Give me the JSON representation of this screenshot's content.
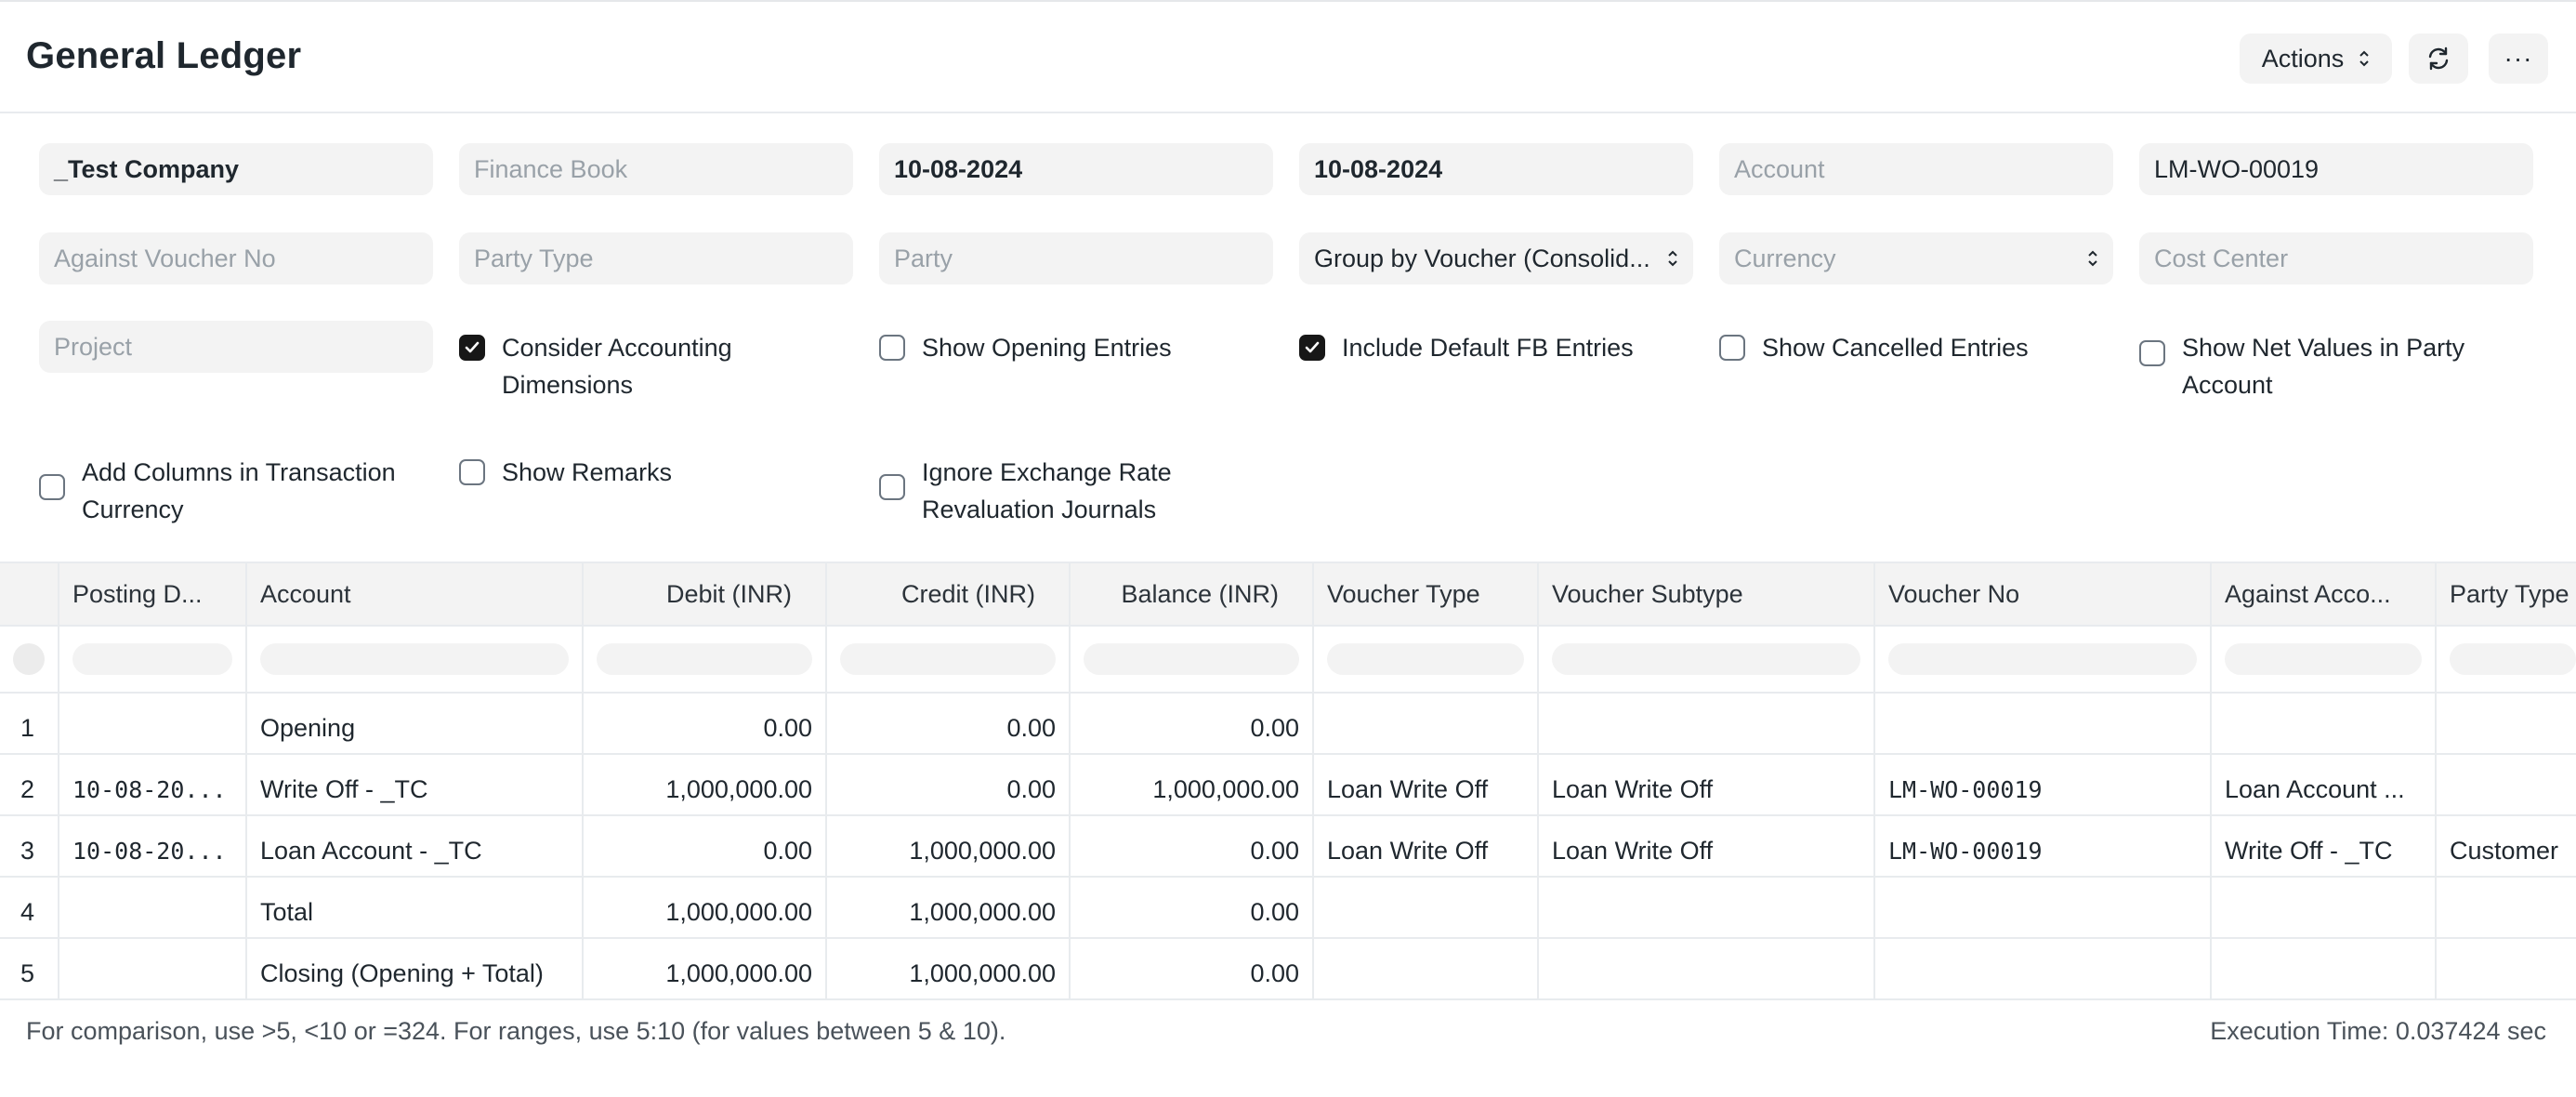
{
  "page": {
    "title": "General Ledger",
    "actions_label": "Actions",
    "refresh_icon": "refresh-icon",
    "more_label": "···"
  },
  "filters": {
    "company": "_Test Company",
    "finance_book_placeholder": "Finance Book",
    "from_date": "10-08-2024",
    "to_date": "10-08-2024",
    "account_placeholder": "Account",
    "voucher_no": "LM-WO-00019",
    "against_voucher_placeholder": "Against Voucher No",
    "party_type_placeholder": "Party Type",
    "party_placeholder": "Party",
    "group_by": "Group by Voucher (Consolid...",
    "currency_placeholder": "Currency",
    "cost_center_placeholder": "Cost Center",
    "project_placeholder": "Project"
  },
  "checkboxes": [
    {
      "label": "Consider Accounting Dimensions",
      "checked": true
    },
    {
      "label": "Show Opening Entries",
      "checked": false
    },
    {
      "label": "Include Default FB Entries",
      "checked": true
    },
    {
      "label": "Show Cancelled Entries",
      "checked": false
    },
    {
      "label": "Show Net Values in Party Account",
      "checked": false
    },
    {
      "label": "Add Columns in Transaction Currency",
      "checked": false
    },
    {
      "label": "Show Remarks",
      "checked": false
    },
    {
      "label": "Ignore Exchange Rate Revaluation Journals",
      "checked": false
    }
  ],
  "checkbox_lines": {
    "c0": [
      "Consider Accounting",
      "Dimensions"
    ],
    "c4": [
      "Show Net Values in Party",
      "Account"
    ],
    "c5": [
      "Add Columns in Transaction",
      "Currency"
    ],
    "c7": [
      "Ignore Exchange Rate",
      "Revaluation Journals"
    ]
  },
  "table": {
    "columns": [
      "Posting D...",
      "Account",
      "Debit (INR)",
      "Credit (INR)",
      "Balance (INR)",
      "Voucher Type",
      "Voucher Subtype",
      "Voucher No",
      "Against Acco...",
      "Party Type"
    ],
    "rows": [
      {
        "idx": "1",
        "posting_date": "",
        "account": "Opening",
        "debit": "0.00",
        "credit": "0.00",
        "balance": "0.00",
        "voucher_type": "",
        "voucher_subtype": "",
        "voucher_no": "",
        "against_account": "",
        "party_type": ""
      },
      {
        "idx": "2",
        "posting_date": "10-08-20...",
        "account": "Write Off - _TC",
        "debit": "1,000,000.00",
        "credit": "0.00",
        "balance": "1,000,000.00",
        "voucher_type": "Loan Write Off",
        "voucher_subtype": "Loan Write Off",
        "voucher_no": "LM-WO-00019",
        "against_account": "Loan Account ...",
        "party_type": ""
      },
      {
        "idx": "3",
        "posting_date": "10-08-20...",
        "account": "Loan Account - _TC",
        "debit": "0.00",
        "credit": "1,000,000.00",
        "balance": "0.00",
        "voucher_type": "Loan Write Off",
        "voucher_subtype": "Loan Write Off",
        "voucher_no": "LM-WO-00019",
        "against_account": "Write Off - _TC",
        "party_type": "Customer"
      },
      {
        "idx": "4",
        "posting_date": "",
        "account": "Total",
        "debit": "1,000,000.00",
        "credit": "1,000,000.00",
        "balance": "0.00",
        "voucher_type": "",
        "voucher_subtype": "",
        "voucher_no": "",
        "against_account": "",
        "party_type": ""
      },
      {
        "idx": "5",
        "posting_date": "",
        "account": "Closing (Opening + Total)",
        "debit": "1,000,000.00",
        "credit": "1,000,000.00",
        "balance": "0.00",
        "voucher_type": "",
        "voucher_subtype": "",
        "voucher_no": "",
        "against_account": "",
        "party_type": ""
      }
    ]
  },
  "footer": {
    "hint": "For comparison, use >5, <10 or =324. For ranges, use 5:10 (for values between 5 & 10).",
    "execution_time": "Execution Time: 0.037424 sec"
  }
}
